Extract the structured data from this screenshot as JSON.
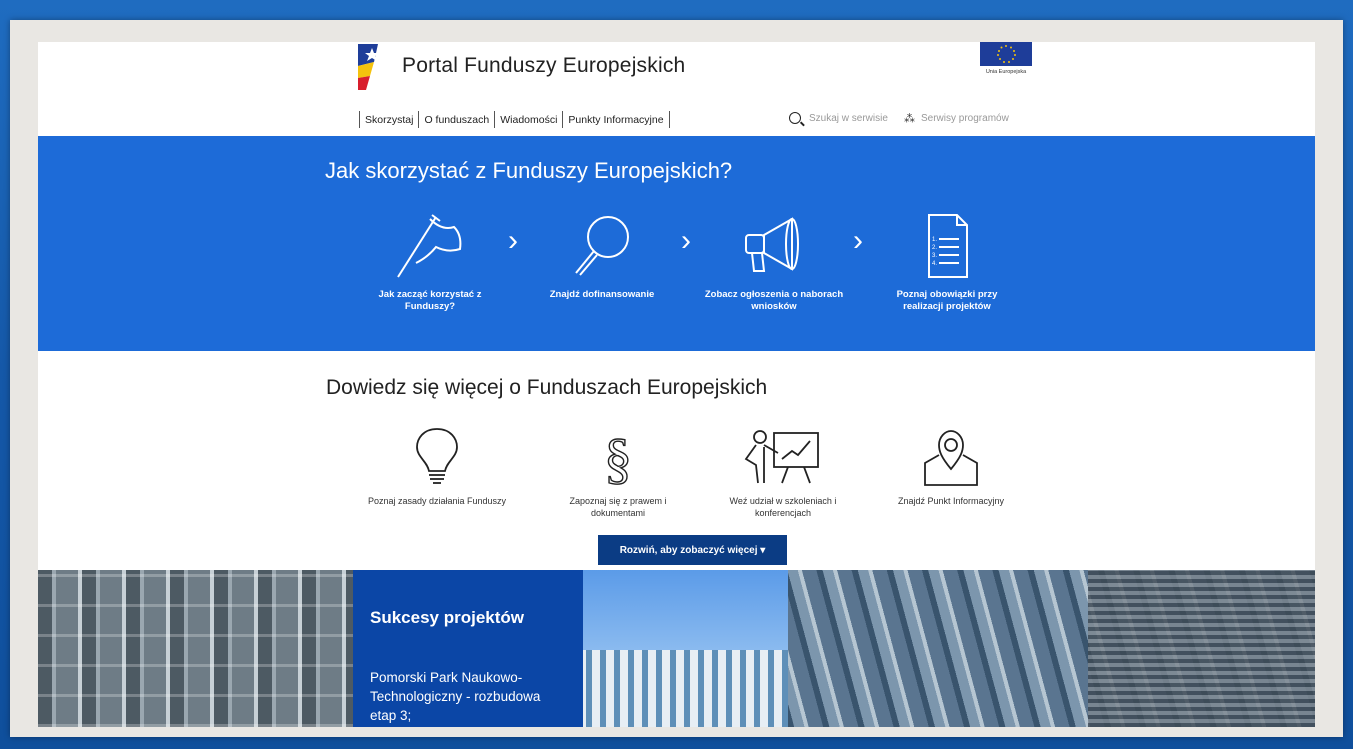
{
  "header": {
    "title": "Portal Funduszy Europejskich",
    "eu_label": "Unia Europejska",
    "nav": [
      "Skorzystaj",
      "O funduszach",
      "Wiadomości",
      "Punkty Informacyjne"
    ],
    "search_placeholder": "Szukaj w serwisie",
    "services_label": "Serwisy programów"
  },
  "band": {
    "heading": "Jak skorzystać z Funduszy Europejskich?",
    "steps": [
      "Jak zacząć korzystać z Funduszy?",
      "Znajdź dofinansowanie",
      "Zobacz ogłoszenia o naborach wniosków",
      "Poznaj obowiązki przy realizacji projektów"
    ]
  },
  "learn": {
    "heading": "Dowiedz się więcej o Funduszach Europejskich",
    "items": [
      "Poznaj zasady działania Funduszy",
      "Zapoznaj się z prawem i dokumentami",
      "Weź udział w szkoleniach i konferencjach",
      "Znajdź Punkt Informacyjny"
    ],
    "expand_label": "Rozwiń, aby zobaczyć więcej ▾"
  },
  "success": {
    "heading": "Sukcesy projektów",
    "text": "Pomorski Park Naukowo-Technologiczny - rozbudowa etap 3;"
  },
  "colors": {
    "band_blue": "#1d6bd8",
    "button_navy": "#0b3c84",
    "success_blue": "#0b46a6"
  }
}
